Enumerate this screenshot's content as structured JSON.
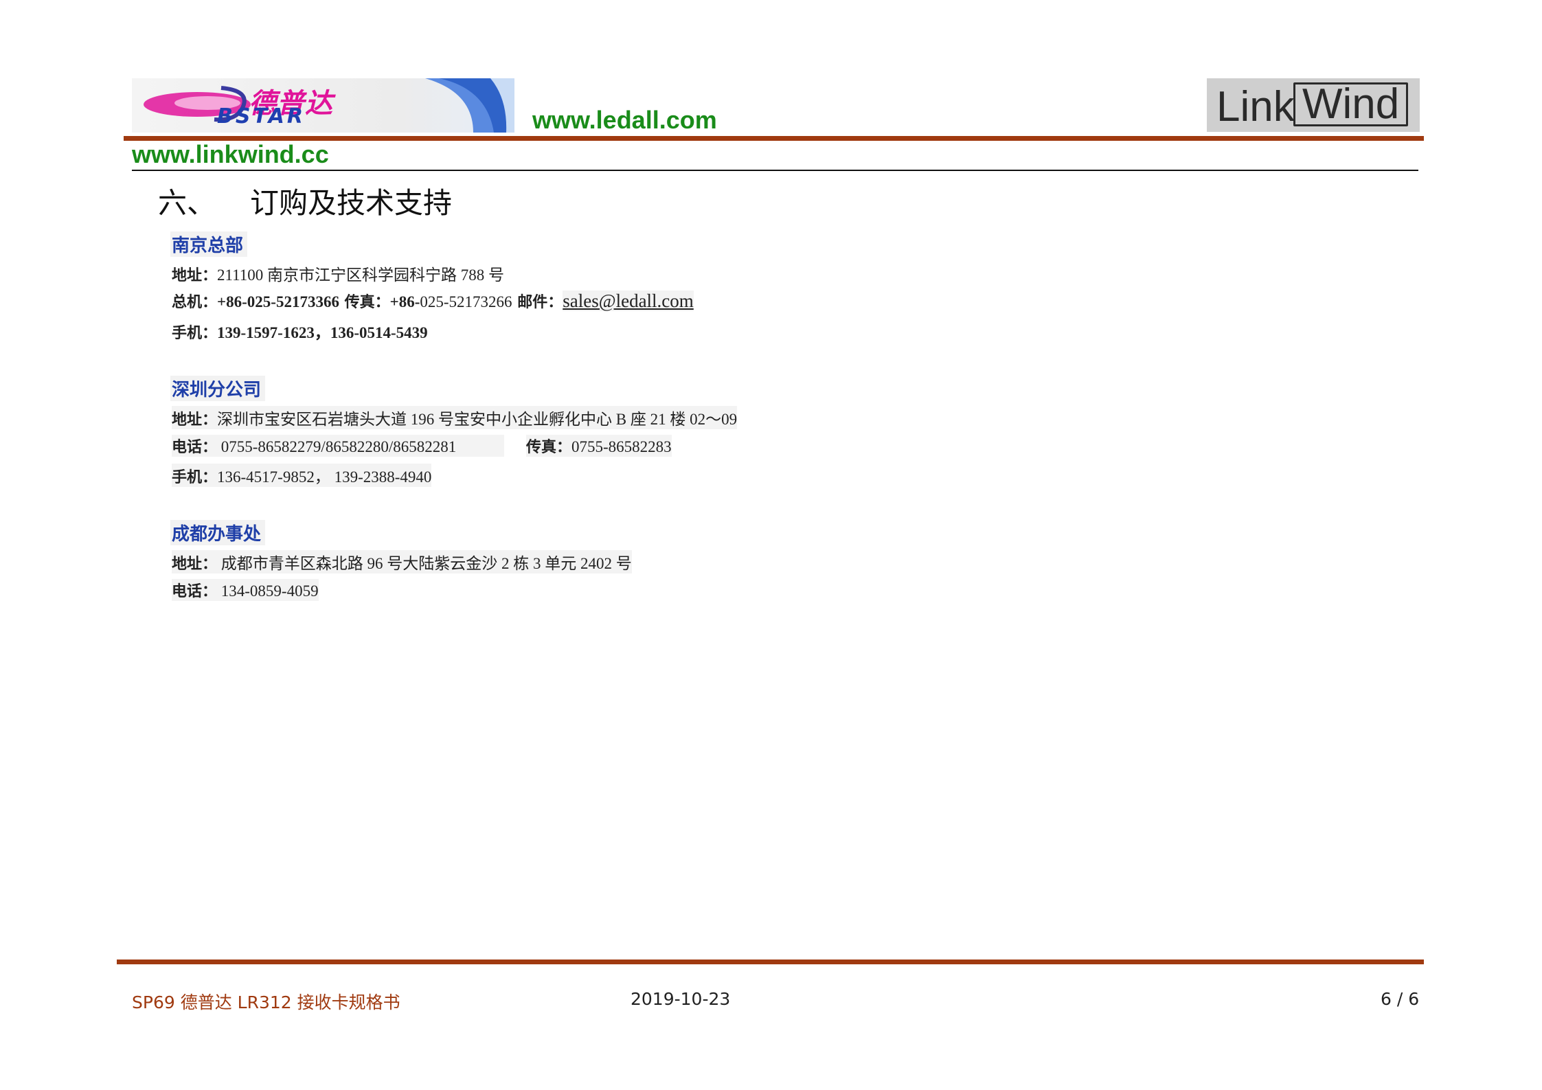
{
  "header": {
    "bstar_logo_cn": "德普达",
    "bstar_logo_en": "BSTAR",
    "url_ledall": "www.ledall.com",
    "url_linkwind": "www.linkwind.cc",
    "linkwind_logo_link": "Link",
    "linkwind_logo_wind": "Wind"
  },
  "section": {
    "number": "六、",
    "title": "订购及技术支持"
  },
  "offices": {
    "nanjing": {
      "heading": "南京总部",
      "addr_label": "地址：",
      "addr_value": "211100 南京市江宁区科学园科宁路 788 号",
      "phone_label": "总机：",
      "phone_value": "+86-025-52173366",
      "fax_label": " 传真：",
      "fax_prefix": "+86-",
      "fax_value": "025-52173266",
      "email_label": " 邮件：",
      "email_value": "sales@ledall.com",
      "mobile_label": "手机：",
      "mobile_value": "139-1597-1623，136-0514-5439"
    },
    "shenzhen": {
      "heading": "深圳分公司",
      "addr_label": "地址：",
      "addr_value": "深圳市宝安区石岩塘头大道 196 号宝安中小企业孵化中心 B 座 21 楼 02～09",
      "tel_label": "电话：",
      "tel_value": " 0755-86582279/86582280/86582281",
      "fax_label": "传真：",
      "fax_value": "0755-86582283",
      "mobile_label": "手机：",
      "mobile_value": "136-4517-9852，  139-2388-4940"
    },
    "chengdu": {
      "heading": "成都办事处",
      "addr_label": "地址：",
      "addr_value": " 成都市青羊区森北路 96 号大陆紫云金沙 2 栋 3 单元 2402 号",
      "tel_label": "电话：",
      "tel_value": "  134-0859-4059"
    }
  },
  "footer": {
    "doc_code": "SP69",
    "doc_name_1": " 德普达 ",
    "doc_model": "LR312",
    "doc_name_2": " 接收卡规格书",
    "date": "2019-10-23",
    "page": "6 / 6"
  },
  "colors": {
    "accent_rule": "#a03a10",
    "url_green": "#1a8c1a",
    "heading_blue": "#1f3fa8"
  }
}
